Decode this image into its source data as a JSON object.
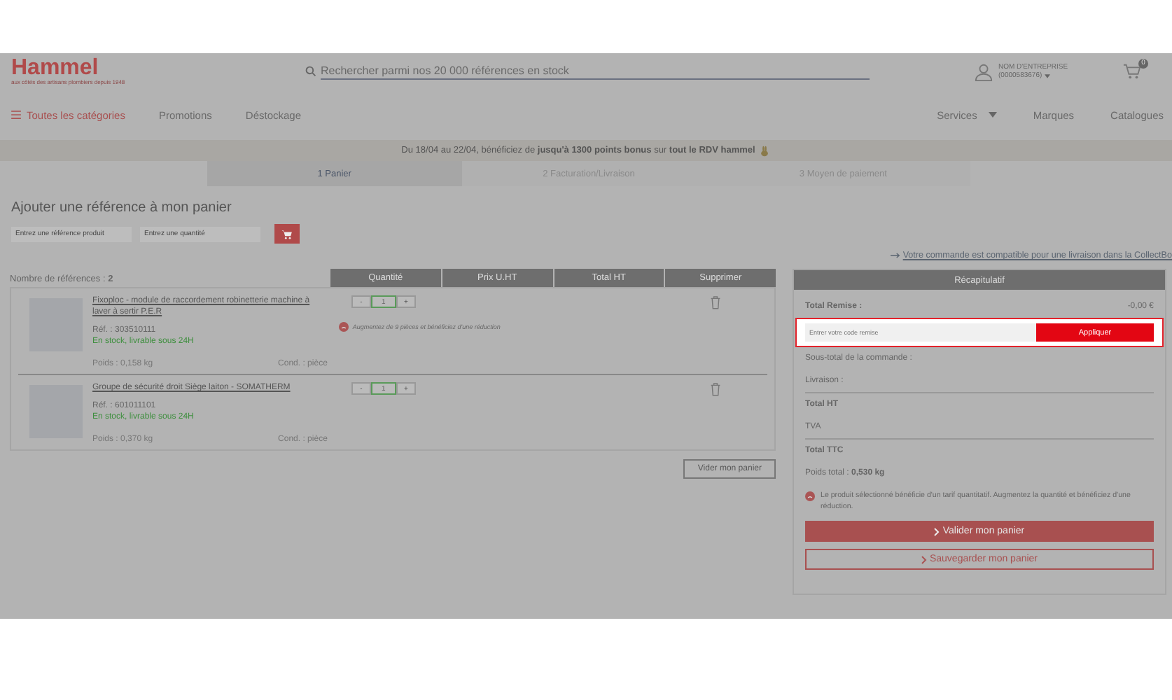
{
  "header": {
    "logo": "Hammel",
    "tagline": "aux côtés des artisans plombiers depuis 1948",
    "search": {
      "placeholder": "Rechercher parmi nos 20 000 références en stock"
    },
    "account": {
      "name": "NOM D'ENTREPRISE",
      "number": "(0000583676)"
    },
    "cart_count": "0"
  },
  "nav": {
    "left": [
      {
        "label": "Toutes les catégories",
        "kind": "menu"
      },
      {
        "label": "Promotions",
        "kind": "link"
      },
      {
        "label": "Déstockage",
        "kind": "link"
      }
    ],
    "right": [
      {
        "label": "Services",
        "kind": "dropdown"
      },
      {
        "label": "Marques",
        "kind": "link"
      },
      {
        "label": "Catalogues",
        "kind": "link"
      }
    ]
  },
  "banner": "Du 18/04 au 22/04, bénéficiez de **jusqu'à 1300 points bonus** sur **tout le RDV hammel**",
  "steps": [
    {
      "label": "1 Panier",
      "selected": true
    },
    {
      "label": "2 Facturation/Livraison",
      "selected": false
    },
    {
      "label": "3 Moyen de paiement",
      "selected": false
    }
  ],
  "add_reference": {
    "title": "Ajouter une référence à mon panier",
    "reference": {
      "placeholder": "Entrez une référence produit"
    },
    "quantity": {
      "placeholder": "Entrez une quantité"
    }
  },
  "collect_link": "Votre commande est compatible pour une livraison dans la CollectBo",
  "cart": {
    "count_label": "Nombre de références : **2**",
    "columns": [
      "Quantité",
      "Prix U.HT",
      "Total HT",
      "Supprimer"
    ],
    "items": [
      {
        "name": "Fixoploc - module de raccordement robinetterie machine à laver à sertir P.E.R",
        "ref": "Réf. : 303510111",
        "stock": "En stock, livrable sous 24H",
        "weight": "Poids : 0,158 kg",
        "cond": "Cond. : pièce",
        "minus": "-",
        "quantity": "1",
        "plus": "+",
        "warning": "Augmentez de 9 pièces et bénéficiez d'une réduction"
      },
      {
        "name": "Groupe de sécurité droit Siège laiton - SOMATHERM",
        "ref": "Réf. : 601011101",
        "stock": "En stock, livrable sous 24H",
        "weight": "Poids : 0,370 kg",
        "cond": "Cond. : pièce",
        "minus": "-",
        "quantity": "1",
        "plus": "+"
      }
    ],
    "empty_button": "Vider mon panier"
  },
  "summary": {
    "title": "Récapitulatif",
    "discount": {
      "label": "Total Remise :",
      "value": "-0,00 €"
    },
    "code": {
      "placeholder": "Entrer votre code remise",
      "button": "Appliquer",
      "highlighted": true
    },
    "rows": [
      {
        "label": "Sous-total de la commande :",
        "kind": "plain"
      },
      {
        "label": "Livraison :",
        "kind": "plain"
      },
      {
        "label": "Total HT",
        "kind": "total"
      },
      {
        "label": "TVA",
        "kind": "plain"
      },
      {
        "label": "Total TTC",
        "kind": "total"
      }
    ],
    "weight": "Poids total : **0,530 kg**",
    "notice": "Le produit sélectionné bénéficie d'un tarif quantitatif. Augmentez la quantité et bénéficiez d'une réduction.",
    "validate": "Valider mon panier",
    "save": "Sauvegarder mon panier"
  }
}
